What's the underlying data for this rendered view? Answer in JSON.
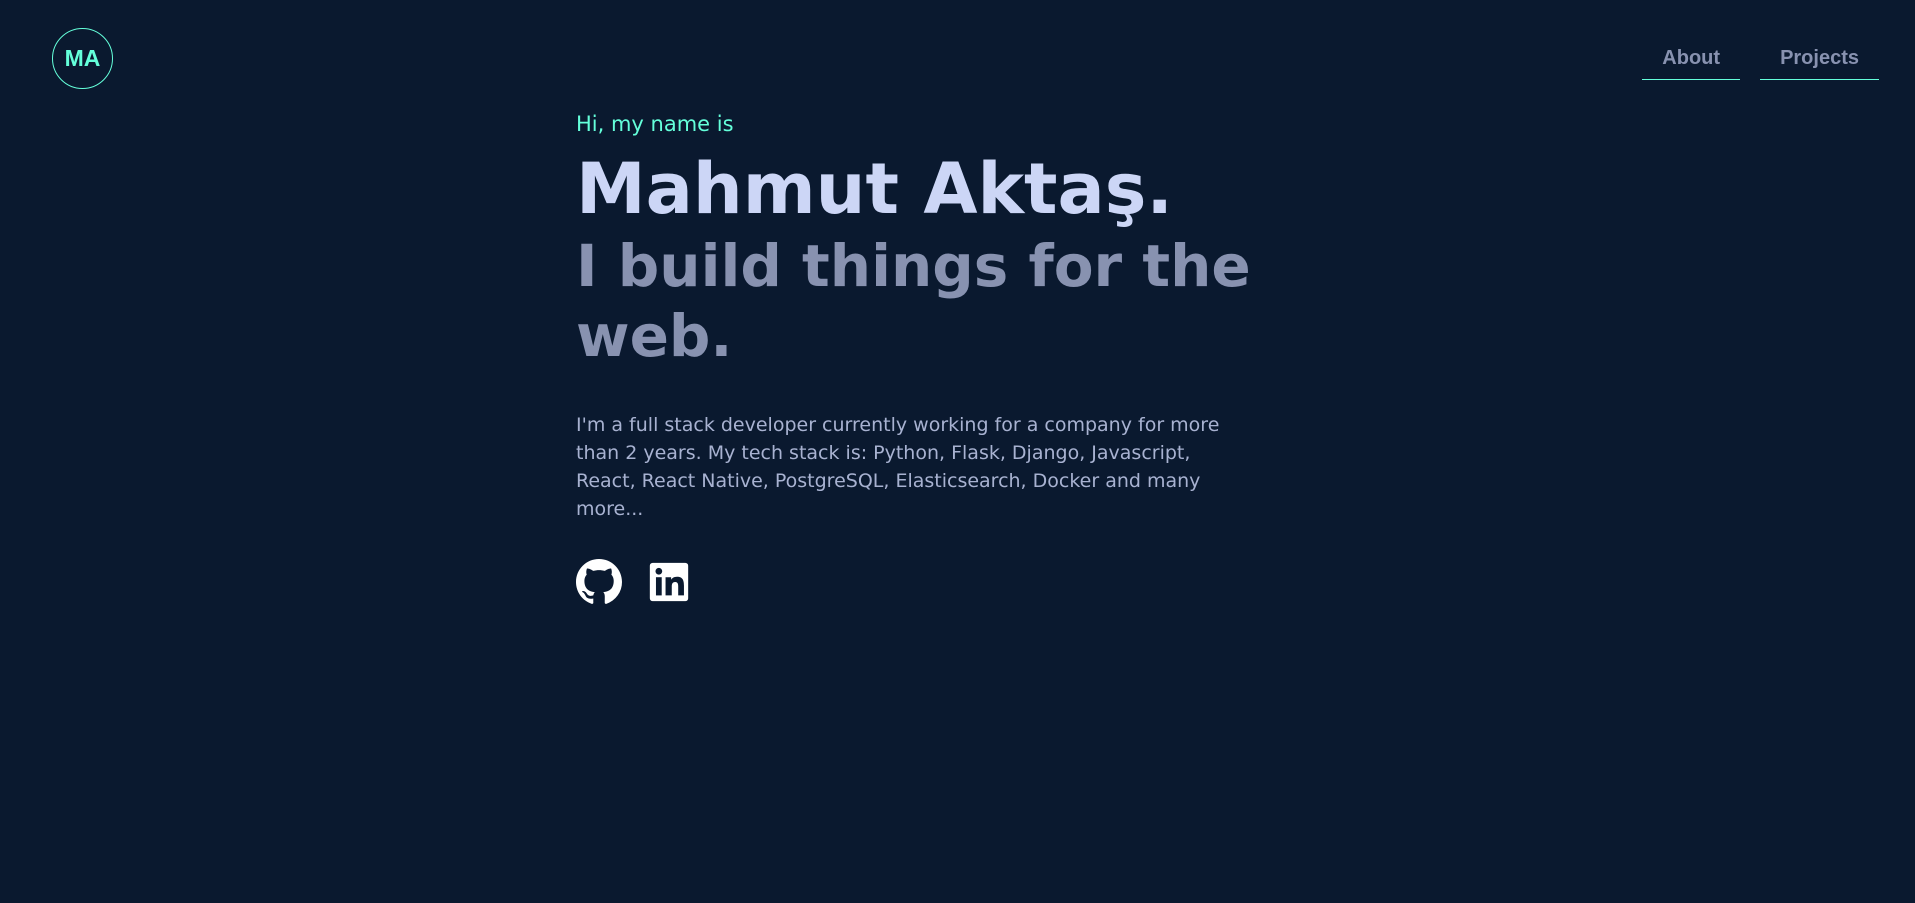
{
  "header": {
    "logo_text": "MA",
    "nav": [
      {
        "label": "About"
      },
      {
        "label": "Projects"
      }
    ]
  },
  "hero": {
    "greeting": "Hi, my name is",
    "name": "Mahmut Aktaş.",
    "tagline": "I build things for the web.",
    "bio": "I'm a full stack developer currently working for a company for more than 2 years. My tech stack is: Python, Flask, Django, Javascript, React, React Native, PostgreSQL, Elasticsearch, Docker and many more..."
  },
  "socials": [
    {
      "icon": "github-icon"
    },
    {
      "icon": "linkedin-icon"
    }
  ],
  "colors": {
    "background": "#0a192f",
    "accent": "#64ffda",
    "heading": "#ccd6f6",
    "muted": "#8892b0"
  }
}
